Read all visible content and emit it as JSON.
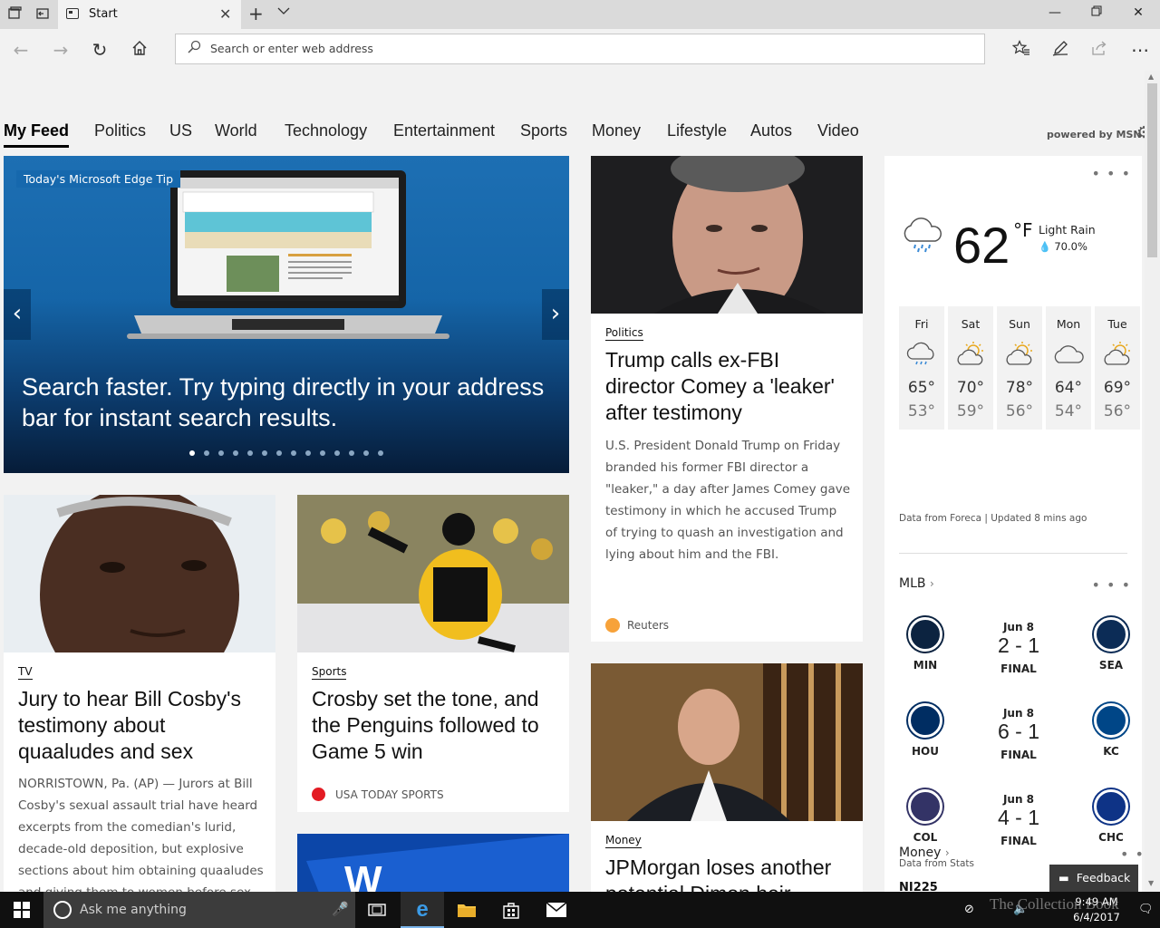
{
  "browser": {
    "tab_title": "Start",
    "address_placeholder": "Search or enter web address"
  },
  "feed_nav": {
    "tabs": [
      "My Feed",
      "Politics",
      "US",
      "World",
      "Technology",
      "Entertainment",
      "Sports",
      "Money",
      "Lifestyle",
      "Autos",
      "Video"
    ],
    "powered_by": "powered by MSN"
  },
  "hero": {
    "tip_label": "Today's Microsoft Edge Tip",
    "text": "Search faster. Try typing directly in your address bar for instant search results.",
    "slide_count": 14,
    "active_slide": 1
  },
  "articles": {
    "comey": {
      "category": "Politics",
      "headline": "Trump calls ex-FBI director Comey a 'leaker' after testimony",
      "summary": "U.S. President Donald Trump on Friday branded his former FBI director a \"leaker,\" a day after James Comey gave testimony in which he accused Trump of trying to quash an investigation and lying about him and the FBI.",
      "source": "Reuters"
    },
    "cosby": {
      "category": "TV",
      "headline": "Jury to hear Bill Cosby's testimony about quaaludes and sex",
      "summary": "NORRISTOWN, Pa. (AP) — Jurors at Bill Cosby's sexual assault trial have heard excerpts from the comedian's lurid, decade-old deposition, but explosive sections about him obtaining quaaludes and giving them to women before sex"
    },
    "crosby": {
      "category": "Sports",
      "headline": "Crosby set the tone, and the Penguins followed to Game 5 win",
      "source": "USA TODAY SPORTS"
    },
    "jpmorgan": {
      "category": "Money",
      "headline": "JPMorgan loses another potential Dimon heir"
    }
  },
  "weather": {
    "temp": "62",
    "unit": "°F",
    "condition": "Light Rain",
    "precip": "70.0%",
    "forecast": [
      {
        "day": "Fri",
        "hi": "65°",
        "lo": "53°",
        "icon": "rain-cloud-icon"
      },
      {
        "day": "Sat",
        "hi": "70°",
        "lo": "59°",
        "icon": "partly-sunny-icon"
      },
      {
        "day": "Sun",
        "hi": "78°",
        "lo": "56°",
        "icon": "partly-sunny-icon"
      },
      {
        "day": "Mon",
        "hi": "64°",
        "lo": "54°",
        "icon": "cloud-icon"
      },
      {
        "day": "Tue",
        "hi": "69°",
        "lo": "56°",
        "icon": "partly-sunny-icon"
      }
    ],
    "source_note": "Data from Foreca | Updated 8 mins ago"
  },
  "mlb": {
    "title": "MLB",
    "games": [
      {
        "date": "Jun 8",
        "score": "2 - 1",
        "status": "FINAL",
        "home": "MIN",
        "away": "SEA",
        "home_color": "#0c2340",
        "away_color": "#0c2c56"
      },
      {
        "date": "Jun 8",
        "score": "6 - 1",
        "status": "FINAL",
        "home": "HOU",
        "away": "KC",
        "home_color": "#002d62",
        "away_color": "#004687"
      },
      {
        "date": "Jun 8",
        "score": "4 - 1",
        "status": "FINAL",
        "home": "COL",
        "away": "CHC",
        "home_color": "#333366",
        "away_color": "#0e3386"
      }
    ],
    "source_note": "Data from Stats"
  },
  "money": {
    "title": "Money",
    "first_item": "NI225"
  },
  "feedback_label": "Feedback",
  "taskbar": {
    "search_placeholder": "Ask me anything",
    "time": "9:49 AM",
    "date": "6/4/2017"
  },
  "watermark": "The Collection Book"
}
